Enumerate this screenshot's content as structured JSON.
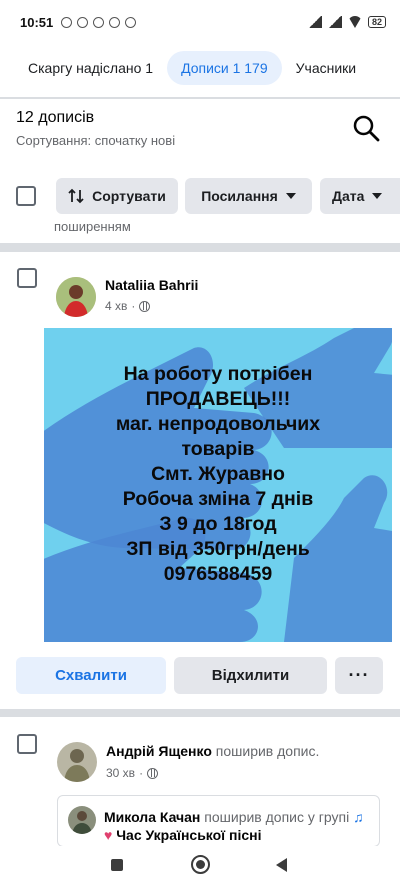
{
  "status_bar": {
    "time": "10:51",
    "battery": "82",
    "icons": [
      "mute-icon",
      "alarm-icon",
      "telegram-icon",
      "viber-icon",
      "messenger-icon",
      "dot-icon"
    ]
  },
  "tabs": [
    {
      "label": "Скаргу надіслано 1",
      "active": false
    },
    {
      "label": "Дописи 1 179",
      "active": true
    },
    {
      "label": "Учасники",
      "active": false
    }
  ],
  "header": {
    "count": "12 дописів",
    "sort_info": "Сортування: спочатку нові"
  },
  "filters": {
    "sort_label": "Сортувати",
    "links_label": "Посилання",
    "date_label": "Дата",
    "overflow_text": "поширенням"
  },
  "post1": {
    "author": "Nataliia Bahrii",
    "time": "4 хв",
    "image_lines": [
      "На роботу потрібен",
      "ПРОДАВЕЦЬ!!!",
      "маг. непродовольчих",
      "товарів",
      "Смт. Журавно",
      "Робоча зміна 7 днів",
      "З 9 до 18год",
      "ЗП від 350грн/день",
      "0976588459"
    ],
    "actions": {
      "approve": "Схвалити",
      "decline": "Відхилити",
      "more": "···"
    }
  },
  "post2": {
    "author": "Андрій Ященко",
    "action": "поширив допис.",
    "time": "30 хв",
    "shared": {
      "author": "Микола Качан",
      "action": "поширив допис у групі",
      "group": "Час Української пісні"
    }
  },
  "colors": {
    "accent": "#1b74e4",
    "accent_bg": "#e7f0fd",
    "button_bg": "#e4e6eb",
    "separator": "#dadde1",
    "image_bg": "#6fd0ee"
  }
}
